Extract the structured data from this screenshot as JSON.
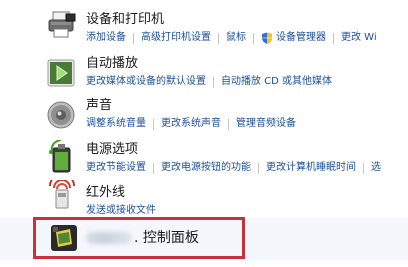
{
  "sections": [
    {
      "title": "设备和打印机",
      "icon": "printer-icon",
      "links": [
        "添加设备",
        "高级打印机设置",
        "鼠标",
        "设备管理器",
        "更改 Wi"
      ]
    },
    {
      "title": "自动播放",
      "icon": "autoplay-icon",
      "links": [
        "更改媒体或设备的默认设置",
        "自动播放 CD 或其他媒体"
      ]
    },
    {
      "title": "声音",
      "icon": "speaker-icon",
      "links": [
        "调整系统音量",
        "更改系统声音",
        "管理音频设备"
      ]
    },
    {
      "title": "电源选项",
      "icon": "power-options-icon",
      "links": [
        "更改节能设置",
        "更改电源按钮的功能",
        "更改计算机睡眠时间",
        "选"
      ]
    },
    {
      "title": "红外线",
      "icon": "infrared-icon",
      "links": [
        "发送或接收文件"
      ]
    }
  ],
  "highlighted_item": {
    "title": ". 控制面板",
    "icon": "control-panel-icon"
  },
  "colors": {
    "link": "#1a4f9c",
    "title": "#1a1a1a",
    "highlight_border": "#c8323c",
    "highlight_bg": "#f4f7fc"
  }
}
